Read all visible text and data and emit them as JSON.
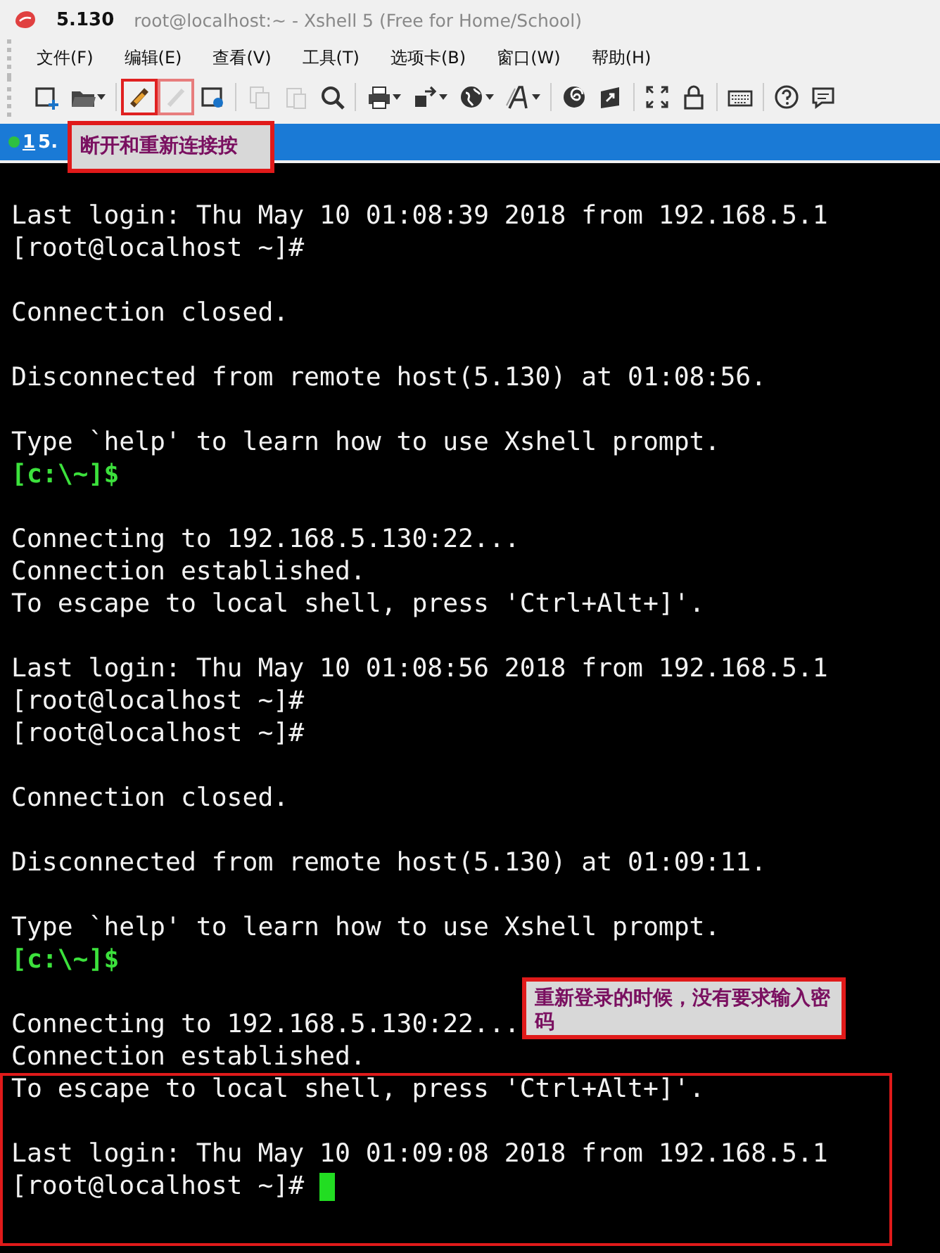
{
  "window": {
    "tab_title": "5.130",
    "title": "root@localhost:~ - Xshell 5 (Free for Home/School)"
  },
  "menu": [
    "文件(F)",
    "编辑(E)",
    "查看(V)",
    "工具(T)",
    "选项卡(B)",
    "窗口(W)",
    "帮助(H)"
  ],
  "toolbar": [
    {
      "kind": "new-session",
      "dropdown": false,
      "disabled": false,
      "highlighted": false
    },
    {
      "kind": "open",
      "dropdown": true,
      "disabled": false,
      "highlighted": false
    },
    {
      "kind": "separator"
    },
    {
      "kind": "reconnect",
      "dropdown": false,
      "disabled": false,
      "highlighted": true
    },
    {
      "kind": "disconnect",
      "dropdown": false,
      "disabled": true,
      "highlighted": true
    },
    {
      "kind": "properties",
      "dropdown": false,
      "disabled": false,
      "highlighted": false
    },
    {
      "kind": "separator"
    },
    {
      "kind": "copy",
      "dropdown": false,
      "disabled": true,
      "highlighted": false
    },
    {
      "kind": "paste",
      "dropdown": false,
      "disabled": true,
      "highlighted": false
    },
    {
      "kind": "find",
      "dropdown": false,
      "disabled": false,
      "highlighted": false
    },
    {
      "kind": "separator"
    },
    {
      "kind": "print",
      "dropdown": true,
      "disabled": false,
      "highlighted": false
    },
    {
      "kind": "transfer",
      "dropdown": true,
      "disabled": false,
      "highlighted": false
    },
    {
      "kind": "globe",
      "dropdown": true,
      "disabled": false,
      "highlighted": false
    },
    {
      "kind": "font",
      "dropdown": true,
      "disabled": false,
      "highlighted": false
    },
    {
      "kind": "separator"
    },
    {
      "kind": "spiral",
      "dropdown": false,
      "disabled": false,
      "highlighted": false
    },
    {
      "kind": "folder-arrow",
      "dropdown": false,
      "disabled": false,
      "highlighted": false
    },
    {
      "kind": "separator"
    },
    {
      "kind": "fullscreen",
      "dropdown": false,
      "disabled": false,
      "highlighted": false
    },
    {
      "kind": "lock",
      "dropdown": false,
      "disabled": false,
      "highlighted": false
    },
    {
      "kind": "separator"
    },
    {
      "kind": "keyboard",
      "dropdown": false,
      "disabled": false,
      "highlighted": false
    },
    {
      "kind": "separator"
    },
    {
      "kind": "help",
      "dropdown": false,
      "disabled": false,
      "highlighted": false
    },
    {
      "kind": "chat",
      "dropdown": false,
      "disabled": false,
      "highlighted": false
    }
  ],
  "tabs": [
    {
      "number": "1",
      "label": "5.",
      "selected": true,
      "connected": true
    }
  ],
  "terminal": {
    "lines": [
      {
        "kind": "output",
        "text": "Last login: Thu May 10 01:08:39 2018 from 192.168.5.1"
      },
      {
        "kind": "output",
        "text": "[root@localhost ~]#"
      },
      {
        "kind": "blank"
      },
      {
        "kind": "output",
        "text": "Connection closed."
      },
      {
        "kind": "blank"
      },
      {
        "kind": "output",
        "text": "Disconnected from remote host(5.130) at 01:08:56."
      },
      {
        "kind": "blank"
      },
      {
        "kind": "output",
        "text": "Type `help' to learn how to use Xshell prompt."
      },
      {
        "kind": "local-prompt",
        "text": "[c:\\~]$"
      },
      {
        "kind": "blank"
      },
      {
        "kind": "output",
        "text": "Connecting to 192.168.5.130:22..."
      },
      {
        "kind": "output",
        "text": "Connection established."
      },
      {
        "kind": "output",
        "text": "To escape to local shell, press 'Ctrl+Alt+]'."
      },
      {
        "kind": "blank"
      },
      {
        "kind": "output",
        "text": "Last login: Thu May 10 01:08:56 2018 from 192.168.5.1"
      },
      {
        "kind": "output",
        "text": "[root@localhost ~]#"
      },
      {
        "kind": "output",
        "text": "[root@localhost ~]#"
      },
      {
        "kind": "blank"
      },
      {
        "kind": "output",
        "text": "Connection closed."
      },
      {
        "kind": "blank"
      },
      {
        "kind": "output",
        "text": "Disconnected from remote host(5.130) at 01:09:11."
      },
      {
        "kind": "blank"
      },
      {
        "kind": "output",
        "text": "Type `help' to learn how to use Xshell prompt."
      },
      {
        "kind": "local-prompt",
        "text": "[c:\\~]$"
      },
      {
        "kind": "blank"
      },
      {
        "kind": "output",
        "text": "Connecting to 192.168.5.130:22..."
      },
      {
        "kind": "output",
        "text": "Connection established."
      },
      {
        "kind": "output",
        "text": "To escape to local shell, press 'Ctrl+Alt+]'."
      },
      {
        "kind": "blank"
      },
      {
        "kind": "output",
        "text": "Last login: Thu May 10 01:09:08 2018 from 192.168.5.1"
      },
      {
        "kind": "output",
        "text": "[root@localhost ~]#",
        "cursor": true
      }
    ]
  },
  "annotations": [
    {
      "kind": "tab-note",
      "text": "断开和重新连接按"
    },
    {
      "kind": "terminal-note",
      "text": "重新登录的时候，没有要求输入密码"
    }
  ]
}
